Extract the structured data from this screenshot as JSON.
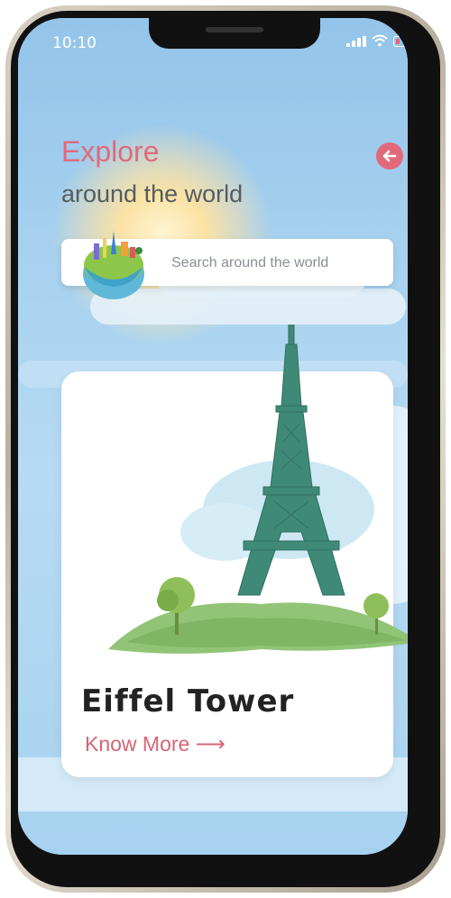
{
  "status_bar": {
    "time": "10:10"
  },
  "header": {
    "title": "Explore",
    "subtitle": "around the world",
    "back_icon": "back-arrow-icon"
  },
  "search": {
    "placeholder": "Search around the world"
  },
  "card": {
    "name": "Eiffel Tower",
    "link": "Know More ⟶"
  },
  "colors": {
    "accent": "#e06a7c",
    "sky": "#9dcaeb",
    "tower": "#3f8a77"
  }
}
